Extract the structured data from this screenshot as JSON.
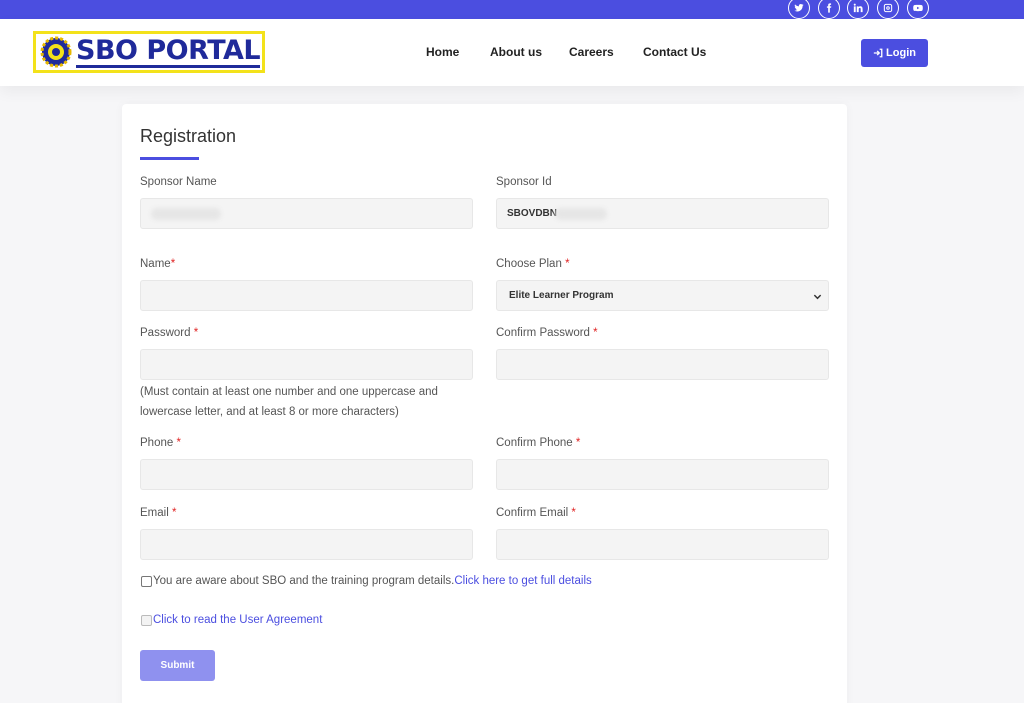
{
  "topbar": {
    "social_icons": [
      "twitter-icon",
      "facebook-icon",
      "linkedin-icon",
      "instagram-icon",
      "youtube-icon"
    ],
    "color": "#4b4ee0"
  },
  "header": {
    "logo_text": "SBO PORTAL",
    "nav": [
      "Home",
      "About us",
      "Careers",
      "Contact Us"
    ],
    "login_label": "Login"
  },
  "form": {
    "title": "Registration",
    "sponsor_name_label": "Sponsor Name",
    "sponsor_id_label": "Sponsor Id",
    "sponsor_id_value": "SBOVDBN",
    "name_label": "Name",
    "choose_plan_label": "Choose Plan",
    "plan_value": "Elite Learner Program",
    "password_label": "Password",
    "confirm_password_label": "Confirm Password",
    "password_hint": "(Must contain at least one number and one uppercase and lowercase letter, and at least 8 or more characters)",
    "phone_label": "Phone",
    "confirm_phone_label": "Confirm Phone",
    "email_label": "Email",
    "confirm_email_label": "Confirm Email",
    "aware_text": "You are aware about SBO and the training program details.",
    "aware_link": "Click here to get full details",
    "agreement_link": "Click to read the User Agreement",
    "submit_label": "Submit",
    "required_marker": "*"
  },
  "colors": {
    "accent": "#4b4ee0",
    "submit": "#8f91ef",
    "required": "#e02424"
  }
}
